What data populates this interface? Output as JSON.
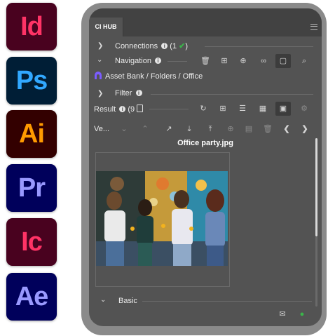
{
  "apps": [
    {
      "name": "InDesign",
      "abbr": "Id",
      "bg": "#49021F",
      "fg": "#FF3366"
    },
    {
      "name": "Photoshop",
      "abbr": "Ps",
      "bg": "#001E36",
      "fg": "#31A8FF"
    },
    {
      "name": "Illustrator",
      "abbr": "Ai",
      "bg": "#330000",
      "fg": "#FF9A00"
    },
    {
      "name": "Premiere Pro",
      "abbr": "Pr",
      "bg": "#00005B",
      "fg": "#9999FF"
    },
    {
      "name": "InCopy",
      "abbr": "Ic",
      "bg": "#49021F",
      "fg": "#FF3366"
    },
    {
      "name": "After Effects",
      "abbr": "Ae",
      "bg": "#00005B",
      "fg": "#9999FF"
    }
  ],
  "panel": {
    "tab_label": "CI HUB",
    "connections": {
      "label": "Connections",
      "count": "(1",
      "close": ")"
    },
    "navigation": {
      "label": "Navigation"
    },
    "breadcrumb": {
      "root": "Asset Bank",
      "sep1": " / ",
      "folder": "Folders",
      "sep2": " / ",
      "current": "Office"
    },
    "filter": {
      "label": "Filter"
    },
    "result": {
      "label": "Result",
      "count": "(9"
    },
    "view": {
      "label": "Ve..."
    },
    "asset": {
      "filename": "Office party.jpg"
    },
    "basic": {
      "label": "Basic"
    }
  },
  "icons": {
    "connections_ok": "checkmark-icon",
    "nav_tools": [
      "trash-icon",
      "add-box-icon",
      "zoom-icon",
      "link-icon",
      "folder-icon",
      "search-icon"
    ],
    "result_tools": [
      "refresh-icon",
      "add-box-icon",
      "list-view-icon",
      "grid-view-icon",
      "detail-view-icon",
      "settings-icon"
    ],
    "view_tools": [
      "chevron-down-icon",
      "chevron-up-icon",
      "open-external-icon",
      "download-icon",
      "upload-icon",
      "zoom-icon",
      "lock-icon",
      "trash-icon",
      "prev-icon",
      "next-icon"
    ],
    "footer": [
      "mail-icon",
      "user-icon"
    ]
  },
  "colors": {
    "accent_green": "#3ab54a",
    "panel_bg": "#535353",
    "frame": "#8a8a8a"
  }
}
